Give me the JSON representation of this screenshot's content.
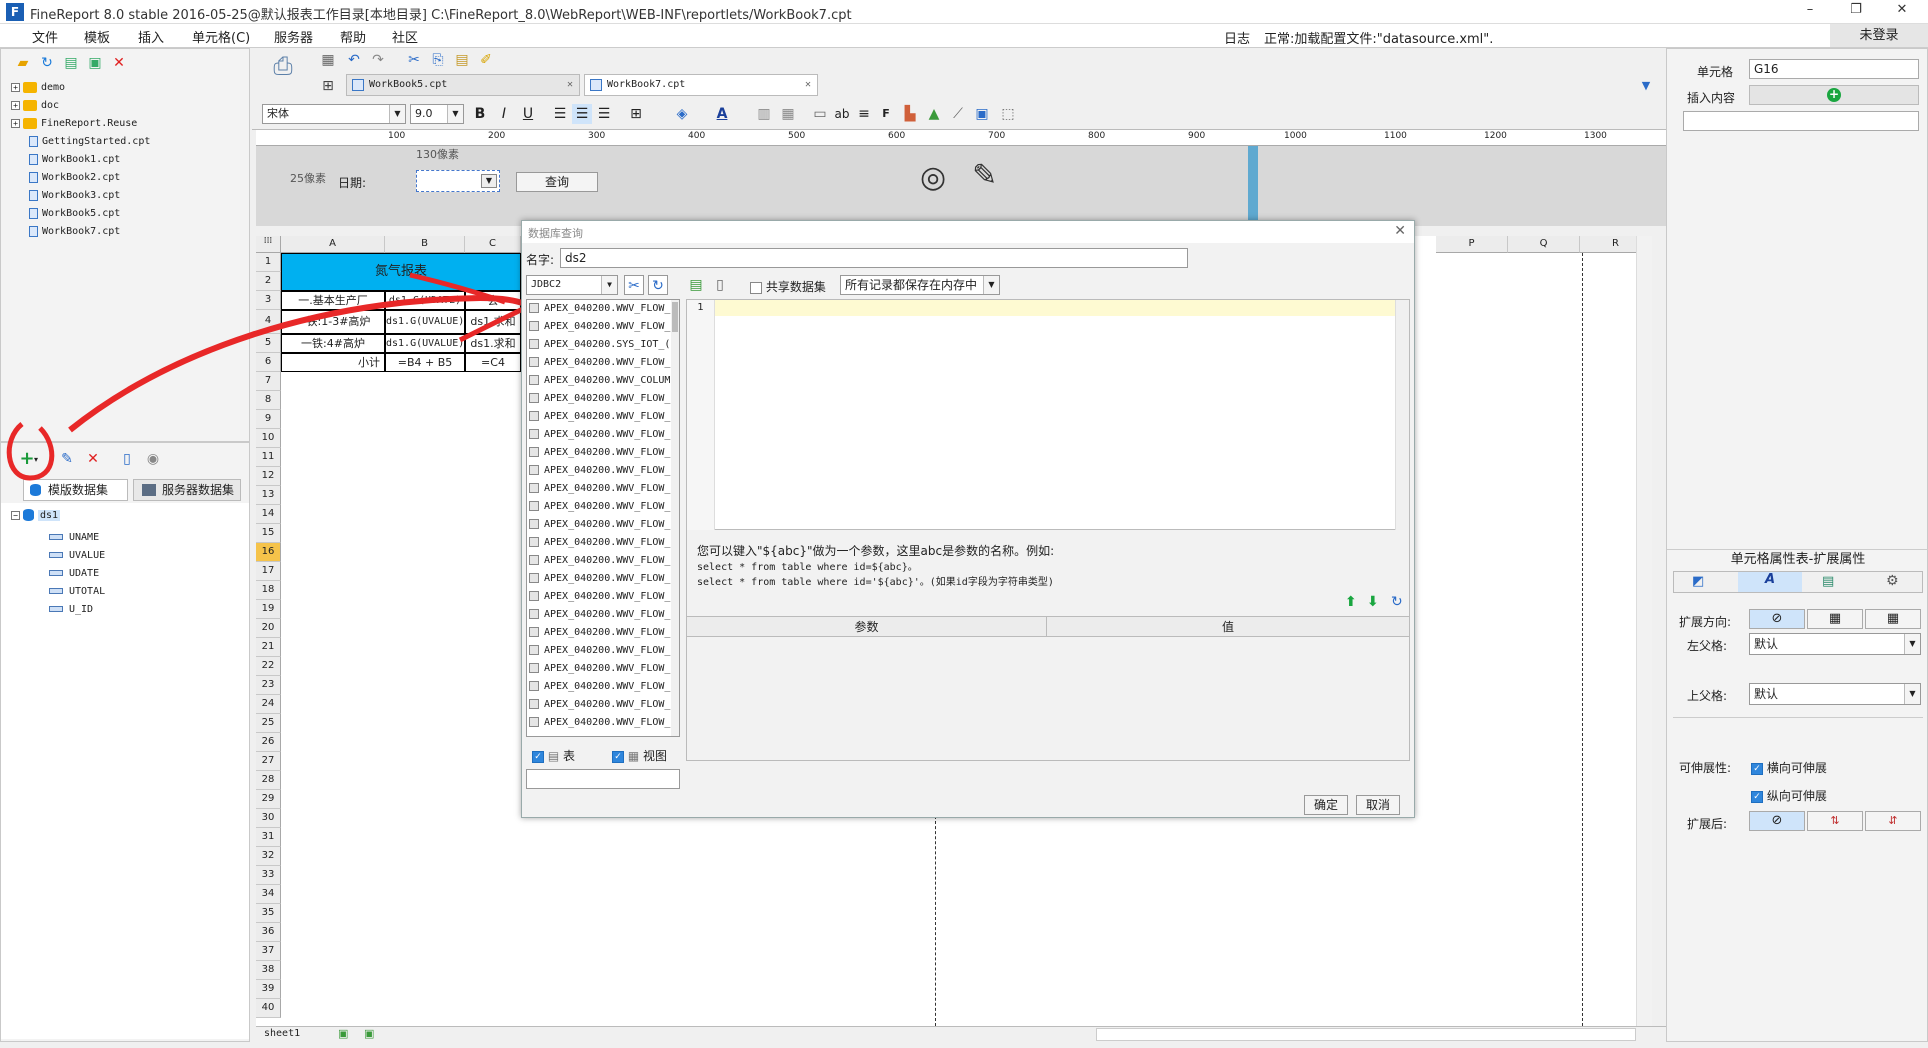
{
  "window": {
    "title": "FineReport 8.0 stable 2016-05-25@默认报表工作目录[本地目录]    C:\\FineReport_8.0\\WebReport\\WEB-INF\\reportlets/WorkBook7.cpt",
    "minimize": "–",
    "restore": "❐",
    "close": "✕"
  },
  "menu": [
    "文件",
    "模板",
    "插入",
    "单元格(C)",
    "服务器",
    "帮助",
    "社区"
  ],
  "status": {
    "log": "日志",
    "message": "正常:加载配置文件:\"datasource.xml\".",
    "login": "未登录"
  },
  "file_tree": {
    "folders": [
      "demo",
      "doc",
      "FineReport.Reuse"
    ],
    "files": [
      "GettingStarted.cpt",
      "WorkBook1.cpt",
      "WorkBook2.cpt",
      "WorkBook3.cpt",
      "WorkBook5.cpt",
      "WorkBook7.cpt"
    ]
  },
  "dataset_panel": {
    "tabs": [
      "模版数据集",
      "服务器数据集"
    ],
    "dataset": "ds1",
    "fields": [
      "UNAME",
      "UVALUE",
      "UDATE",
      "UTOTAL",
      "U_ID"
    ]
  },
  "editor_tabs": [
    "WorkBook5.cpt",
    "WorkBook7.cpt"
  ],
  "format": {
    "font": "宋体",
    "size": "9.0"
  },
  "ruler_ticks": [
    "100",
    "200",
    "300",
    "400",
    "500",
    "600",
    "700",
    "800",
    "900",
    "1000",
    "1100",
    "1200",
    "1300"
  ],
  "param_area": {
    "width_hint": "130像素",
    "height_hint": "25像素",
    "date_label": "日期:",
    "query_button": "查询"
  },
  "columns": [
    "A",
    "B",
    "C",
    "P",
    "Q",
    "R"
  ],
  "rows": [
    "1",
    "2",
    "3",
    "4",
    "5",
    "6",
    "7",
    "8",
    "9",
    "10",
    "11",
    "12",
    "13",
    "14",
    "15",
    "16",
    "17",
    "18",
    "19",
    "20",
    "21",
    "22",
    "23",
    "24",
    "25",
    "26",
    "27",
    "28",
    "29",
    "30",
    "31",
    "32",
    "33",
    "34",
    "35",
    "36",
    "37",
    "38",
    "39",
    "40"
  ],
  "report": {
    "title": "氮气报表",
    "r3": [
      "一.基本生产厂",
      "ds1.G(UDATE)",
      "会"
    ],
    "r4": [
      "一铁:1-3#高炉",
      "ds1.G(UVALUE)",
      "ds1.求和"
    ],
    "r5": [
      "一铁:4#高炉",
      "ds1.G(UVALUE)",
      "ds1.求和"
    ],
    "r6": [
      "小计",
      "=B4 + B5",
      "=C4"
    ]
  },
  "sheet_tab": "sheet1",
  "dialog": {
    "title": "数据库查询",
    "name_label": "名字:",
    "name_value": "ds2",
    "connection": "JDBC2",
    "share_label": "共享数据集",
    "memory_option": "所有记录都保存在内存中",
    "tables": [
      "APEX_040200.WWV_FLOW_",
      "APEX_040200.WWV_FLOW_",
      "APEX_040200.SYS_IOT_(",
      "APEX_040200.WWV_FLOW_",
      "APEX_040200.WWV_COLUM",
      "APEX_040200.WWV_FLOW_",
      "APEX_040200.WWV_FLOW_",
      "APEX_040200.WWV_FLOW_",
      "APEX_040200.WWV_FLOW_",
      "APEX_040200.WWV_FLOW_",
      "APEX_040200.WWV_FLOW_",
      "APEX_040200.WWV_FLOW_",
      "APEX_040200.WWV_FLOW_",
      "APEX_040200.WWV_FLOW_",
      "APEX_040200.WWV_FLOW_",
      "APEX_040200.WWV_FLOW_",
      "APEX_040200.WWV_FLOW_",
      "APEX_040200.WWV_FLOW_",
      "APEX_040200.WWV_FLOW_",
      "APEX_040200.WWV_FLOW_",
      "APEX_040200.WWV_FLOW_",
      "APEX_040200.WWV_FLOW_",
      "APEX_040200.WWV_FLOW_",
      "APEX_040200.WWV_FLOW_"
    ],
    "table_check": "表",
    "view_check": "视图",
    "line_number": "1",
    "hint1": "您可以键入\"${abc}\"做为一个参数，这里abc是参数的名称。例如:",
    "hint2": "select * from table where id=${abc}。",
    "hint3": "select * from table where id='${abc}'。(如果id字段为字符串类型)",
    "param_col": "参数",
    "value_col": "值",
    "ok": "确定",
    "cancel": "取消"
  },
  "right_panel": {
    "cell_label": "单元格",
    "cell_value": "G16",
    "insert_label": "插入内容",
    "props_title": "单元格属性表-扩展属性",
    "expand_dir": "扩展方向:",
    "left_parent": "左父格:",
    "left_parent_value": "默认",
    "top_parent": "上父格:",
    "top_parent_value": "默认",
    "stretch": "可伸展性:",
    "h_stretch": "横向可伸展",
    "v_stretch": "纵向可伸展",
    "after_expand": "扩展后:"
  }
}
